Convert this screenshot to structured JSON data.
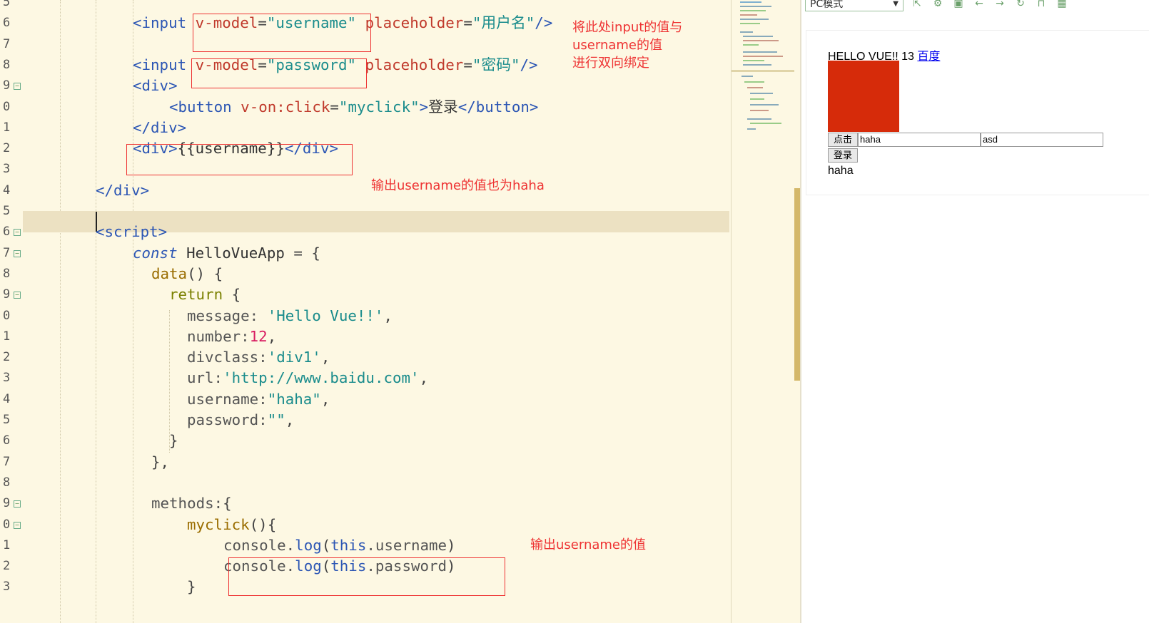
{
  "editor": {
    "line_numbers": [
      "5",
      "6",
      "7",
      "8",
      "9",
      "0",
      "1",
      "2",
      "3",
      "4",
      "5",
      "6",
      "7",
      "8",
      "9",
      "0",
      "1",
      "2",
      "3",
      "4",
      "5",
      "6",
      "7",
      "8",
      "9",
      "0",
      "1",
      "2",
      "3"
    ],
    "lines": [
      [],
      [
        [
          "tag",
          "<input "
        ],
        [
          "attr",
          "v-model"
        ],
        [
          "punct",
          "="
        ],
        [
          "str",
          "\"username\""
        ],
        [
          "txt",
          " "
        ],
        [
          "attr",
          "placeholder"
        ],
        [
          "punct",
          "="
        ],
        [
          "str",
          "\"用户名\""
        ],
        [
          "tag",
          "/>"
        ]
      ],
      [],
      [
        [
          "tag",
          "<input "
        ],
        [
          "attr",
          "v-model"
        ],
        [
          "punct",
          "="
        ],
        [
          "str",
          "\"password\""
        ],
        [
          "txt",
          " "
        ],
        [
          "attr",
          "placeholder"
        ],
        [
          "punct",
          "="
        ],
        [
          "str",
          "\"密码\""
        ],
        [
          "tag",
          "/>"
        ]
      ],
      [
        [
          "tag",
          "<div>"
        ]
      ],
      [
        [
          "tag",
          "<button "
        ],
        [
          "attr",
          "v-on:click"
        ],
        [
          "punct",
          "="
        ],
        [
          "str",
          "\"myclick\""
        ],
        [
          "tag",
          ">"
        ],
        [
          "txt",
          "登录"
        ],
        [
          "tag",
          "</button>"
        ]
      ],
      [
        [
          "tag",
          "</div>"
        ]
      ],
      [
        [
          "tag",
          "<div>"
        ],
        [
          "txt",
          "{{username}}"
        ],
        [
          "tag",
          "</div>"
        ]
      ],
      [],
      [
        [
          "tag",
          "</div>"
        ]
      ],
      [],
      [
        [
          "tag",
          "<script>"
        ]
      ],
      [
        [
          "kw",
          "const"
        ],
        [
          "txt",
          " HelloVueApp "
        ],
        [
          "punct",
          "= {"
        ]
      ],
      [
        [
          "fn",
          "data"
        ],
        [
          "punct",
          "() {"
        ]
      ],
      [
        [
          "ret",
          "return"
        ],
        [
          "punct",
          " {"
        ]
      ],
      [
        [
          "prop",
          "message: "
        ],
        [
          "str",
          "'Hello Vue!!'"
        ],
        [
          "punct",
          ","
        ]
      ],
      [
        [
          "prop",
          "number:"
        ],
        [
          "num",
          "12"
        ],
        [
          "punct",
          ","
        ]
      ],
      [
        [
          "prop",
          "divclass:"
        ],
        [
          "str",
          "'div1'"
        ],
        [
          "punct",
          ","
        ]
      ],
      [
        [
          "prop",
          "url:"
        ],
        [
          "str",
          "'http://www.baidu.com'"
        ],
        [
          "punct",
          ","
        ]
      ],
      [
        [
          "prop",
          "username:"
        ],
        [
          "str",
          "\"haha\""
        ],
        [
          "punct",
          ","
        ]
      ],
      [
        [
          "prop",
          "password:"
        ],
        [
          "str",
          "\"\""
        ],
        [
          "punct",
          ","
        ]
      ],
      [
        [
          "punct",
          "}"
        ]
      ],
      [
        [
          "punct",
          "},"
        ]
      ],
      [],
      [
        [
          "prop",
          "methods:"
        ],
        [
          "punct",
          "{"
        ]
      ],
      [
        [
          "fn",
          "myclick"
        ],
        [
          "punct",
          "(){"
        ]
      ],
      [
        [
          "prop",
          "console."
        ],
        [
          "tag",
          "log"
        ],
        [
          "punct",
          "("
        ],
        [
          "tag",
          "this"
        ],
        [
          "prop",
          ".username"
        ],
        [
          "punct",
          ")"
        ]
      ],
      [
        [
          "prop",
          "console."
        ],
        [
          "tag",
          "log"
        ],
        [
          "punct",
          "("
        ],
        [
          "tag",
          "this"
        ],
        [
          "prop",
          ".password"
        ],
        [
          "punct",
          ")"
        ]
      ],
      [
        [
          "punct",
          "}"
        ]
      ]
    ]
  },
  "annotations": {
    "bind_note": "将此处input的值与\nusername的值\n进行双向绑定",
    "output_note_1": "输出username的值也为haha",
    "output_note_2": "输出username的值"
  },
  "toolbar": {
    "mode_label": "PC模式",
    "icons": [
      "external-icon",
      "gear-icon",
      "terminal-icon",
      "back-arrow-icon",
      "forward-arrow-icon",
      "refresh-icon",
      "lock-icon",
      "qr-icon"
    ]
  },
  "preview": {
    "heading": "HELLO VUE!! 13",
    "link_text": "百度",
    "click_button": "点击",
    "input_username": "haha",
    "input_password": "asd",
    "login_button": "登录",
    "output_text": "haha",
    "square_color": "#d62b0a"
  }
}
